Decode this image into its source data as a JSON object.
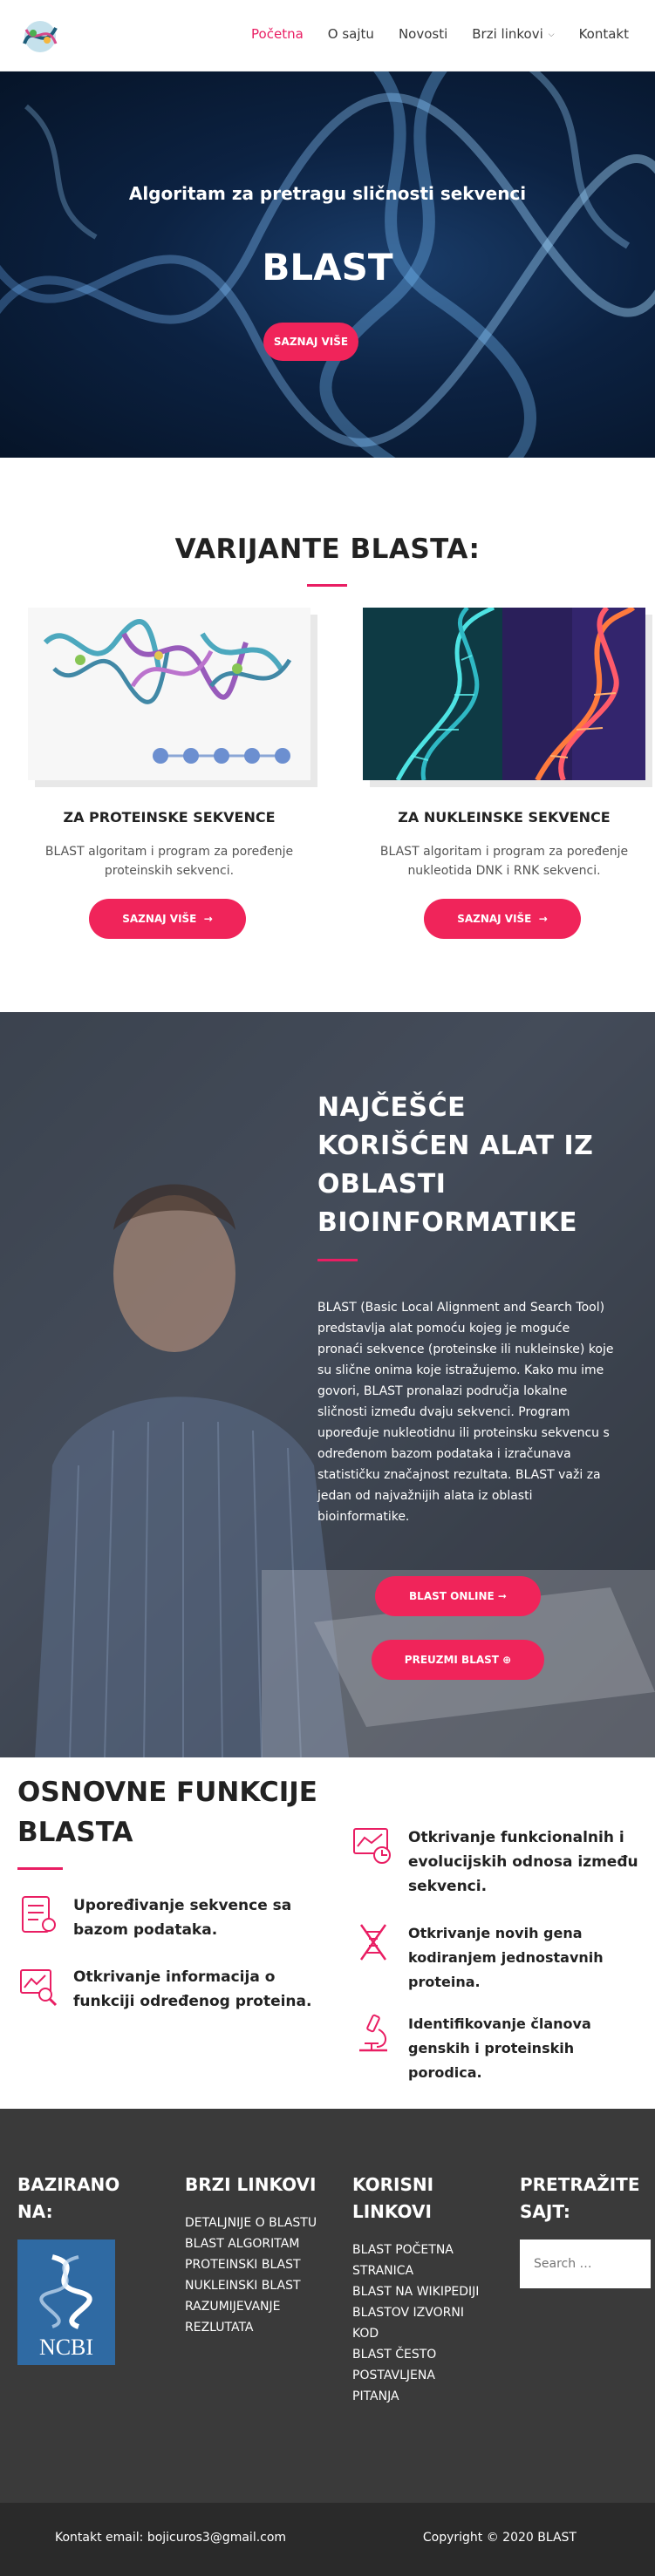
{
  "header": {
    "nav": [
      {
        "label": "Početna"
      },
      {
        "label": "O sajtu"
      },
      {
        "label": "Novosti"
      },
      {
        "label": "Brzi linkovi"
      },
      {
        "label": "Kontakt"
      }
    ],
    "active_color": "#e91e63"
  },
  "hero": {
    "subtitle": "Algoritam za pretragu sličnosti sekvenci",
    "title": "BLAST",
    "button": "SAZNAJ VIŠE"
  },
  "variants": {
    "title": "VARIJANTE BLASTA:",
    "cards": [
      {
        "title": "ZA PROTEINSKE SEKVENCE",
        "text": "BLAST algoritam i program za poređenje proteinskih sekvenci.",
        "button": "SAZNAJ VIŠE",
        "arrow": "→"
      },
      {
        "title": "ZA NUKLEINSKE SEKVENCE",
        "text": "BLAST algoritam i program za poređenje nukleotida DNK i RNK sekvenci.",
        "button": "SAZNAJ VIŠE",
        "arrow": "→"
      }
    ]
  },
  "tool": {
    "title": "NAJČEŠĆE KORIŠĆEN ALAT IZ OBLASTI BIOINFORMATIKE",
    "text": "BLAST (Basic Local Alignment and Search Tool) predstavlja alat pomoću kojeg je moguće pronaći sekvence (proteinske ili nukleinske) koje su slične onima koje istražujemo. Kako mu ime govori, BLAST pronalazi područja lokalne sličnosti između dvaju sekvenci. Program upoređuje nukleotidnu ili proteinsku sekvencu s određenom bazom podataka i izračunava statističku značajnost rezultata. BLAST važi za jedan od najvažnijih alata iz oblasti bioinformatike.",
    "button_online": "BLAST ONLINE ➞",
    "button_download": "PREUZMI BLAST ⊕"
  },
  "functions": {
    "title": "OSNOVNE FUNKCIJE BLASTA",
    "items": [
      {
        "text": "Upoređivanje sekvence sa bazom podataka.",
        "icon": "document-compare-icon"
      },
      {
        "text": "Otkrivanje informacija o funkciji određenog proteina.",
        "icon": "chart-search-icon"
      },
      {
        "text": "Otkrivanje funkcionalnih i evolucijskih odnosa između sekvenci.",
        "icon": "analytics-icon"
      },
      {
        "text": "Otkrivanje novih gena kodiranjem jednostavnih proteina.",
        "icon": "dna-icon"
      },
      {
        "text": "Identifikovanje članova genskih i proteinskih porodica.",
        "icon": "microscope-icon"
      }
    ]
  },
  "footer": {
    "based_title": "BAZIRANO NA:",
    "ncbi": "NCBI",
    "quick_title": "BRZI LINKOVI",
    "quick_links": [
      "DETALJNIJE O BLASTU",
      "BLAST ALGORITAM",
      "PROTEINSKI BLAST",
      "NUKLEINSKI BLAST",
      "RAZUMIJEVANJE",
      "REZLUTATA"
    ],
    "useful_title": "KORISNI LINKOVI",
    "useful_links": [
      "BLAST POČETNA",
      "STRANICA",
      "BLAST NA WIKIPEDIJI",
      "BLASTOV IZVORNI",
      "KOD",
      "BLAST ČESTO",
      "POSTAVLJENA",
      "PITANJA"
    ],
    "search_title": "PRETRAŽITE SAJT:",
    "search_placeholder": "Search …",
    "contact": "Kontakt email: bojicuros3@gmail.com",
    "copyright": "Copyright © 2020 BLAST"
  }
}
